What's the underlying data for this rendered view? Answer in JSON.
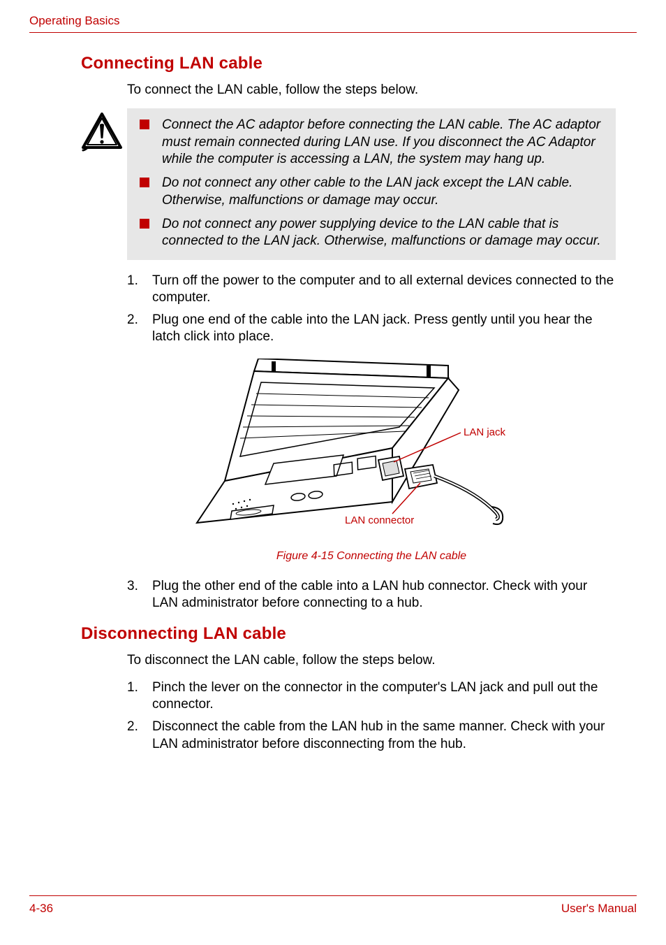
{
  "header": {
    "section": "Operating Basics"
  },
  "section1": {
    "heading": "Connecting LAN cable",
    "intro": "To connect the LAN cable, follow the steps below.",
    "cautions": [
      "Connect the AC adaptor before connecting the LAN cable. The AC adaptor must remain connected during LAN use. If you disconnect the AC Adaptor while the computer is accessing a LAN, the system may hang up.",
      "Do not connect any other cable to the LAN jack except the LAN cable. Otherwise, malfunctions or damage may occur.",
      "Do not connect any power supplying device to the LAN cable that is connected to the LAN jack. Otherwise, malfunctions or damage may occur."
    ],
    "steps_a": [
      {
        "num": "1.",
        "text": "Turn off the power to the computer and to all external devices connected to the computer."
      },
      {
        "num": "2.",
        "text": "Plug one end of the cable into the LAN jack. Press gently until you hear the latch click into place."
      }
    ],
    "figure": {
      "labels": {
        "jack": "LAN jack",
        "connector": "LAN connector"
      },
      "caption": "Figure 4-15 Connecting the LAN cable"
    },
    "steps_b": [
      {
        "num": "3.",
        "text": "Plug the other end of the cable into a LAN hub connector. Check with your LAN administrator before connecting to a hub."
      }
    ]
  },
  "section2": {
    "heading": "Disconnecting LAN cable",
    "intro": "To disconnect the LAN cable, follow the steps below.",
    "steps": [
      {
        "num": "1.",
        "text": "Pinch the lever on the connector in the computer's LAN jack and pull out the connector."
      },
      {
        "num": "2.",
        "text": "Disconnect the cable from the LAN hub in the same manner. Check with your LAN administrator before disconnecting from the hub."
      }
    ]
  },
  "footer": {
    "page": "4-36",
    "manual": "User's Manual"
  }
}
